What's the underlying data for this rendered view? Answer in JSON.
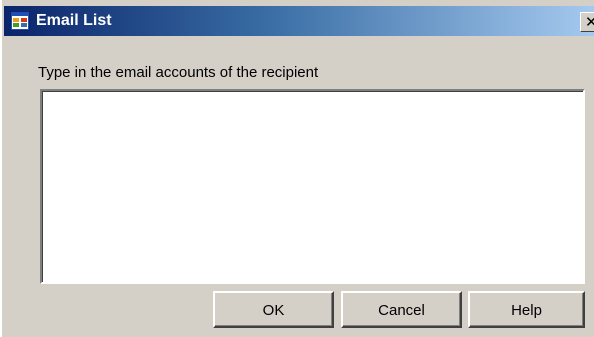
{
  "window": {
    "title": "Email List",
    "close_glyph": "✕"
  },
  "form": {
    "instruction": "Type in the email accounts of the recipient",
    "email_value": ""
  },
  "buttons": {
    "ok_label": "OK",
    "cancel_label": "Cancel",
    "help_label": "Help"
  },
  "icons": {
    "app_icon": "form-window-icon",
    "close_icon": "close-icon"
  },
  "colors": {
    "titlebar_start": "#0a246a",
    "titlebar_end": "#a6caf0",
    "dialog_face": "#d4d0c8"
  }
}
